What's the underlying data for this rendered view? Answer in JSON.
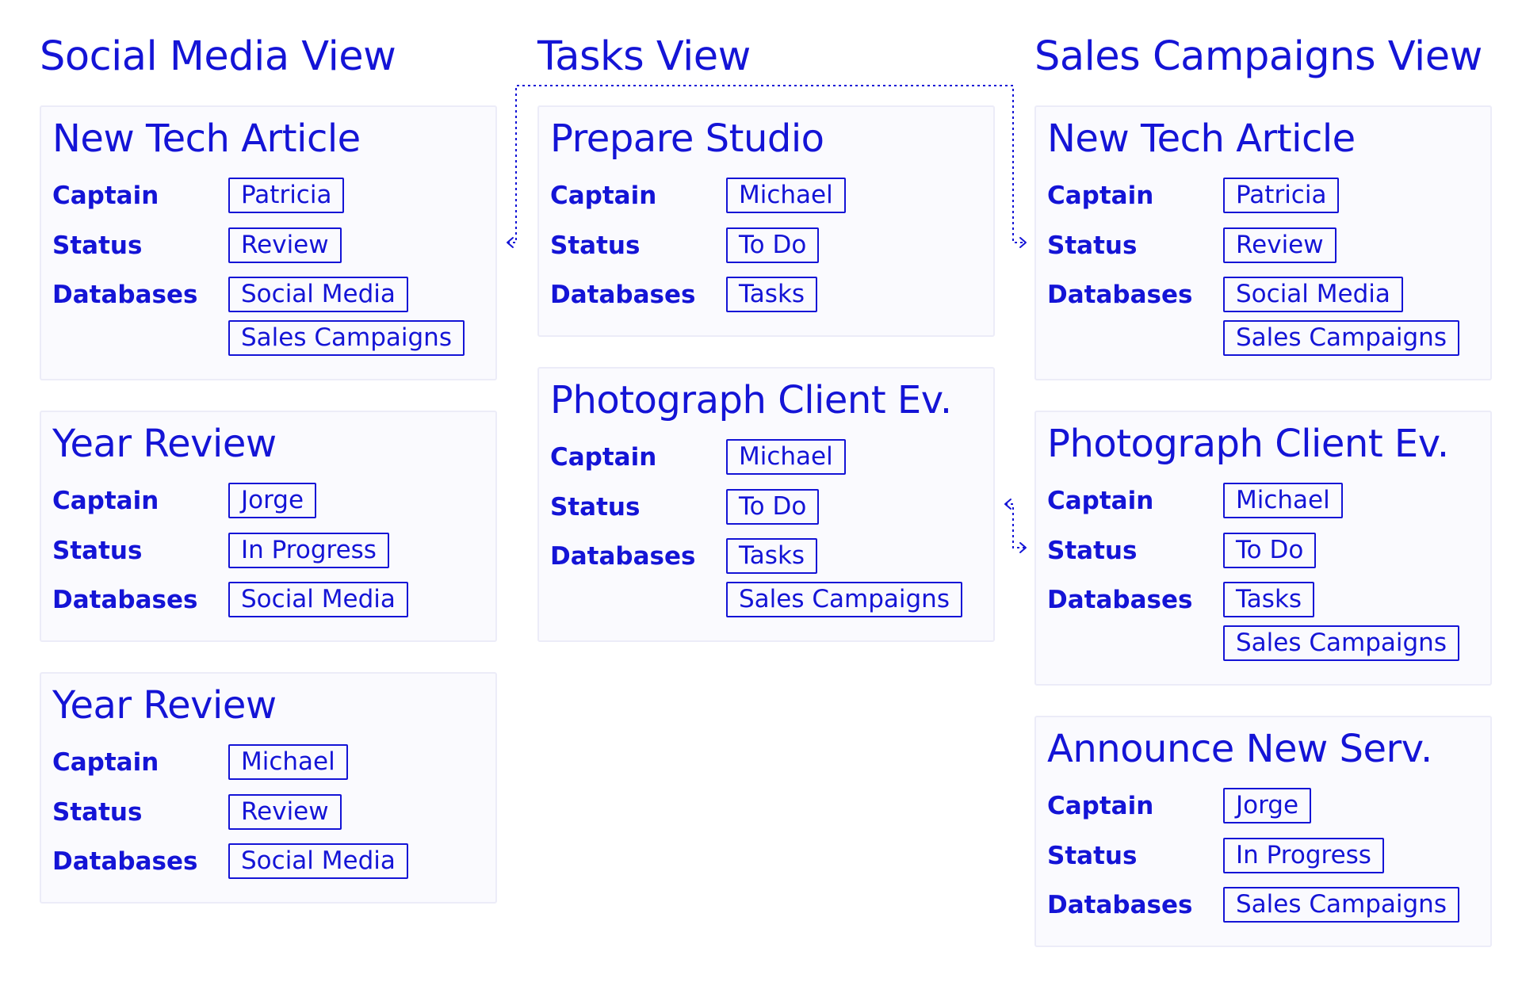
{
  "accent_color": "#1414d6",
  "field_labels": {
    "captain": "Captain",
    "status": "Status",
    "databases": "Databases"
  },
  "columns": [
    {
      "title": "Social Media View",
      "cards": [
        {
          "title": "New Tech Article",
          "captain": "Patricia",
          "status": "Review",
          "databases": [
            "Social Media",
            "Sales Campaigns"
          ]
        },
        {
          "title": "Year Review",
          "captain": "Jorge",
          "status": "In Progress",
          "databases": [
            "Social Media"
          ]
        },
        {
          "title": "Year Review",
          "captain": "Michael",
          "status": "Review",
          "databases": [
            "Social Media"
          ]
        }
      ]
    },
    {
      "title": "Tasks View",
      "cards": [
        {
          "title": "Prepare Studio",
          "captain": "Michael",
          "status": "To Do",
          "databases": [
            "Tasks"
          ]
        },
        {
          "title": "Photograph Client Ev.",
          "captain": "Michael",
          "status": "To Do",
          "databases": [
            "Tasks",
            "Sales Campaigns"
          ]
        }
      ]
    },
    {
      "title": "Sales Campaigns View",
      "cards": [
        {
          "title": "New Tech Article",
          "captain": "Patricia",
          "status": "Review",
          "databases": [
            "Social Media",
            "Sales Campaigns"
          ]
        },
        {
          "title": "Photograph Client Ev.",
          "captain": "Michael",
          "status": "To Do",
          "databases": [
            "Tasks",
            "Sales Campaigns"
          ]
        },
        {
          "title": "Announce New Serv.",
          "captain": "Jorge",
          "status": "In Progress",
          "databases": [
            "Sales Campaigns"
          ]
        }
      ]
    }
  ]
}
